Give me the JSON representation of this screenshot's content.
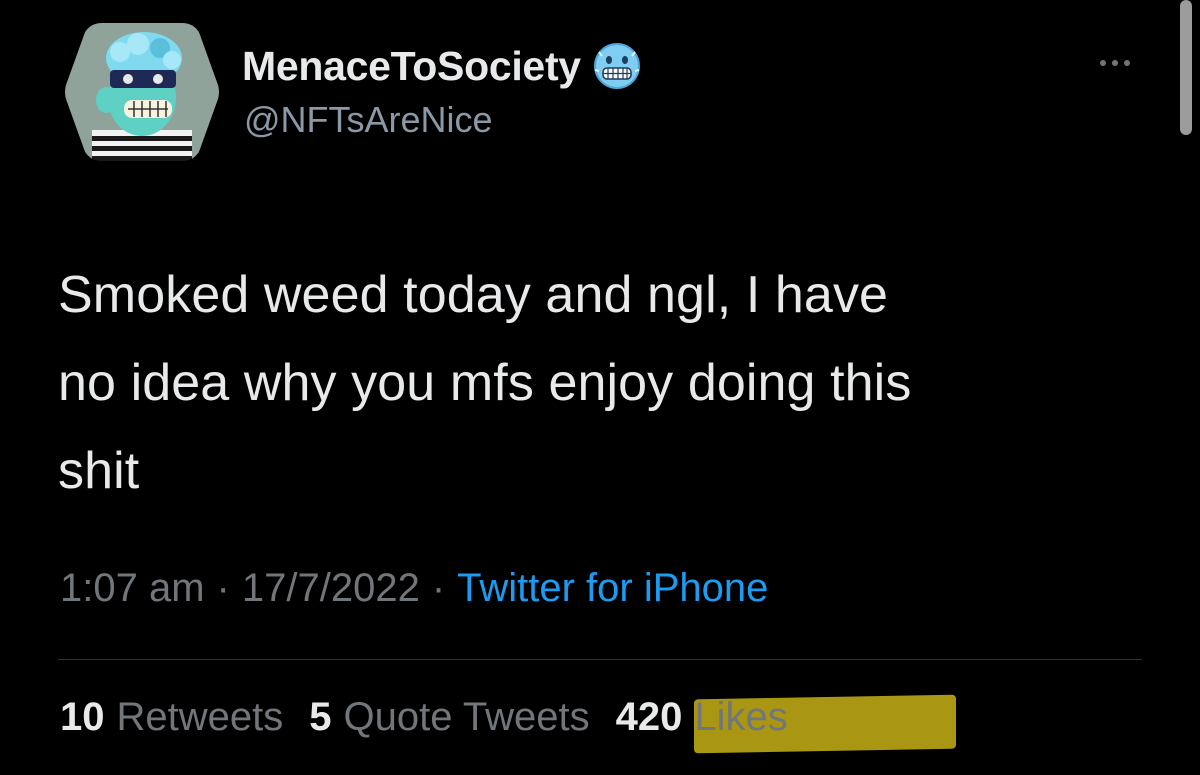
{
  "author": {
    "display_name": "MenaceToSociety",
    "handle": "@NFTsAreNice",
    "badge_icon": "cold-face-emoji-icon"
  },
  "tweet": {
    "text_lines": [
      "Smoked weed today and ngl, I have",
      "no idea why you mfs enjoy doing this",
      "shit"
    ]
  },
  "meta": {
    "time": "1:07 am",
    "separator": "·",
    "date": "17/7/2022",
    "source": "Twitter for iPhone"
  },
  "stats": {
    "retweets_count": "10",
    "retweets_label": "Retweets",
    "quotes_count": "5",
    "quotes_label": "Quote Tweets",
    "likes_count": "420",
    "likes_label": "Likes"
  },
  "colors": {
    "background": "#000000",
    "text_primary": "#e7e9ea",
    "text_secondary": "#71767b",
    "link": "#1d9bf0",
    "highlight": "#d9c21a"
  }
}
